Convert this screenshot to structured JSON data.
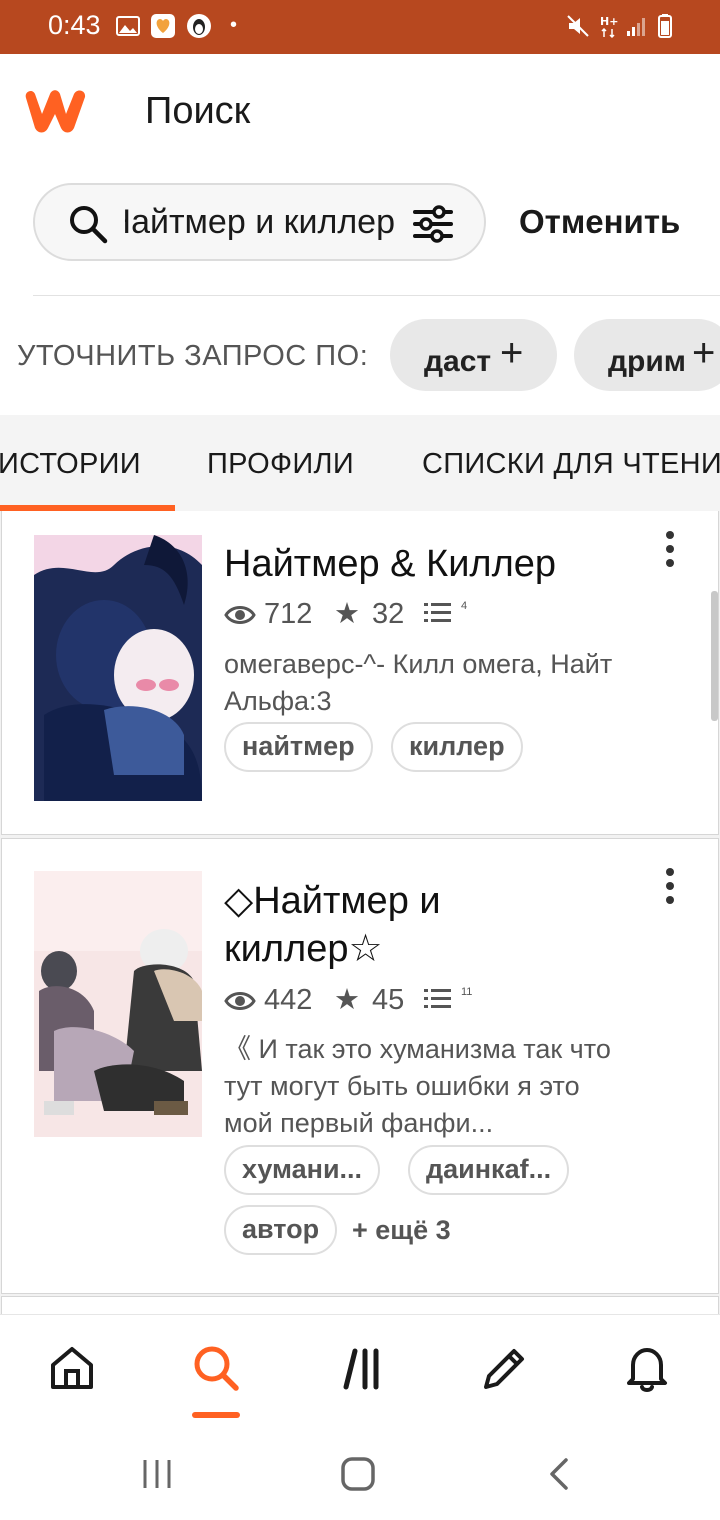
{
  "status_bar": {
    "time": "0:43",
    "icons": [
      "image-icon",
      "heart-app-icon",
      "penguin-app-icon",
      "mute-icon",
      "network-h-plus-icon",
      "signal-icon",
      "battery-icon"
    ]
  },
  "header": {
    "logo": "wattpad-w-logo",
    "title": "Поиск"
  },
  "search": {
    "value": "Найтмер и киллер",
    "cancel_label": "Отменить"
  },
  "refine": {
    "label": "УТОЧНИТЬ ЗАПРОС ПО:",
    "chips": [
      {
        "label": "даст"
      },
      {
        "label": "дрим"
      }
    ]
  },
  "tabs": [
    {
      "label": "ИСТОРИИ",
      "active": true
    },
    {
      "label": "ПРОФИЛИ",
      "active": false
    },
    {
      "label": "СПИСКИ ДЛЯ ЧТЕНИ",
      "active": false
    }
  ],
  "stories": [
    {
      "title": "Найтмер & Киллер",
      "reads": "712",
      "votes": "32",
      "parts": "4",
      "description": "омегаверс-^- Килл омега, Найт Альфа:3",
      "tags": [
        "найтмер",
        "киллер"
      ],
      "more_tags": ""
    },
    {
      "title_line1": "◇Найтмер и",
      "title_line2": "киллер☆",
      "reads": "442",
      "votes": "45",
      "parts": "11",
      "description": "《 И так это хуманизма так что тут могут быть ошибки я это мой первый фанфи...",
      "tags": [
        "хумани...",
        "даинкаf...",
        "автор"
      ],
      "more_tags": "+ ещё 3"
    }
  ],
  "bottom_nav": [
    {
      "name": "home-icon"
    },
    {
      "name": "search-icon",
      "active": true
    },
    {
      "name": "library-icon"
    },
    {
      "name": "write-icon"
    },
    {
      "name": "notifications-icon"
    }
  ],
  "colors": {
    "accent": "#ff6122",
    "status_bar": "#b7481f"
  }
}
